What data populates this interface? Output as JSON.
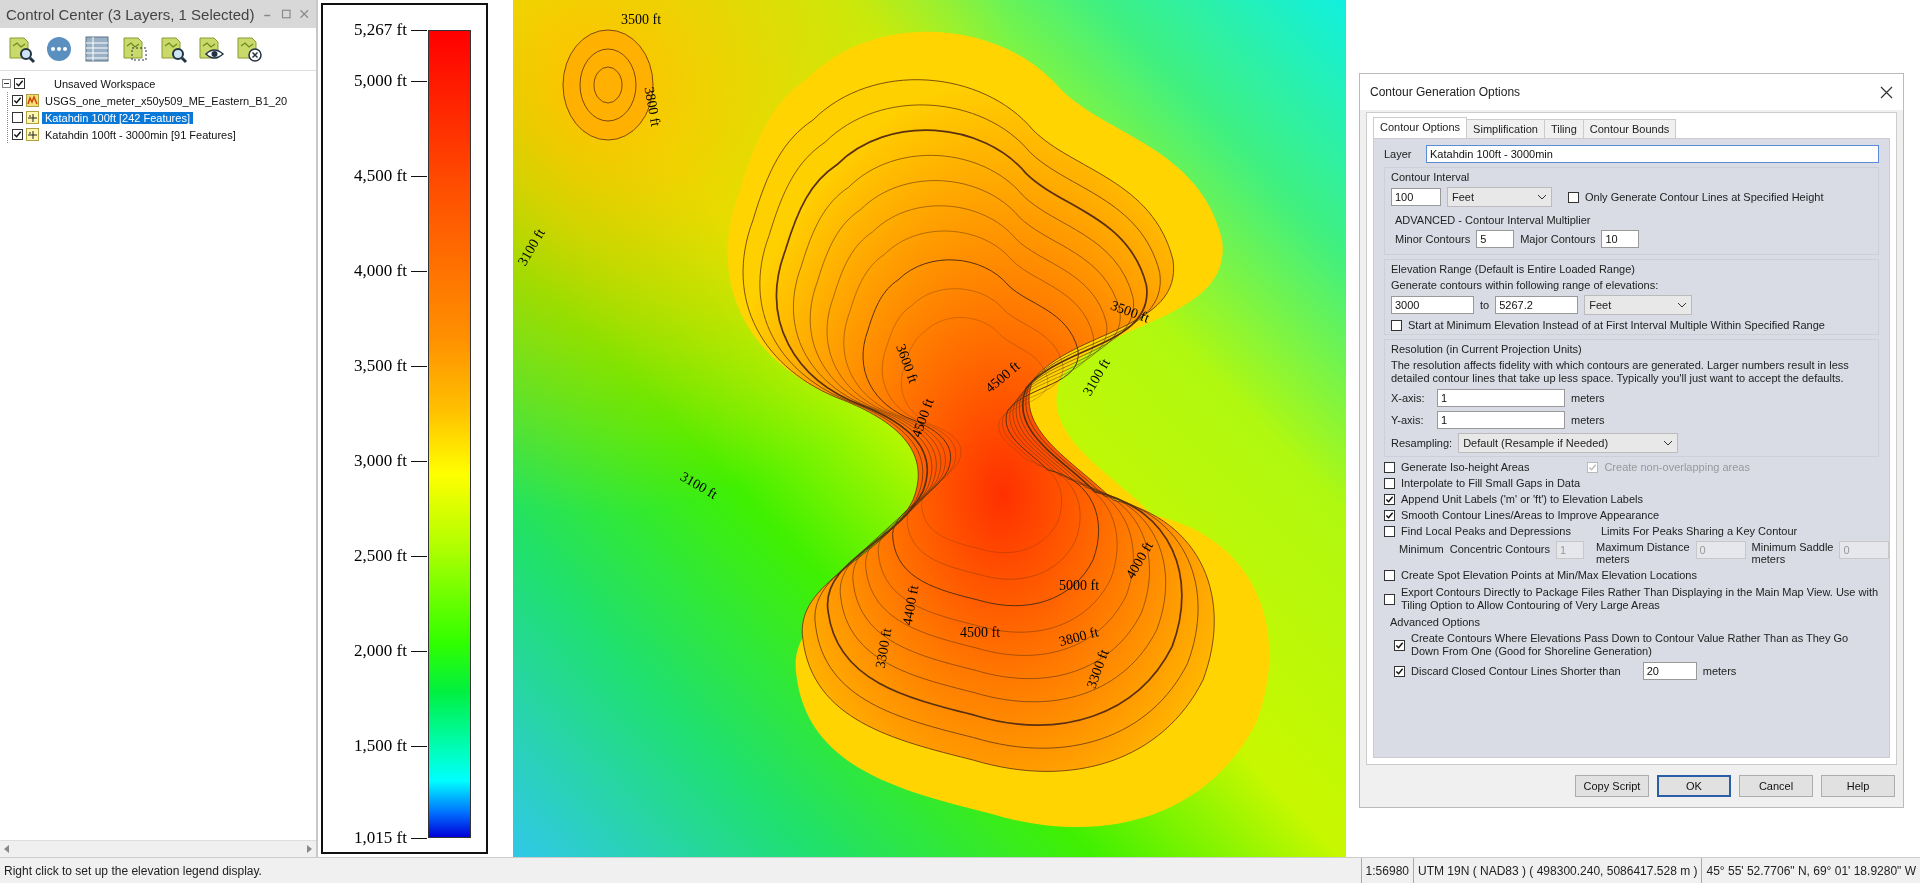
{
  "control_center": {
    "title": "Control Center (3 Layers, 1 Selected)",
    "tree": [
      {
        "label": "Unsaved Workspace",
        "checked": true,
        "expanded": true,
        "children": [
          {
            "label": "USGS_one_meter_x50y509_ME_Eastern_B1_20",
            "kind": "raster",
            "checked": true,
            "selected": false
          },
          {
            "label": "Katahdin 100ft [242 Features]",
            "kind": "vector",
            "checked": false,
            "selected": true
          },
          {
            "label": "Katahdin 100ft - 3000min [91 Features]",
            "kind": "vector",
            "checked": true,
            "selected": false
          }
        ]
      }
    ]
  },
  "legend": {
    "labels": [
      "5,267 ft",
      "5,000 ft",
      "4,500 ft",
      "4,000 ft",
      "3,500 ft",
      "3,000 ft",
      "2,500 ft",
      "2,000 ft",
      "1,500 ft",
      "1,015 ft"
    ]
  },
  "map": {
    "contour_labels": [
      "3500 ft",
      "3800 ft",
      "3100 ft",
      "3500 ft",
      "3600 ft",
      "4500 ft",
      "3100 ft",
      "4500 ft",
      "3100 ft",
      "5000 ft",
      "4000 ft",
      "4400 ft",
      "4500 ft",
      "3800 ft",
      "3300 ft",
      "3300 ft"
    ]
  },
  "dialog": {
    "title": "Contour Generation Options",
    "tabs": [
      {
        "label": "Contour Options",
        "selected": true
      },
      {
        "label": "Simplification",
        "selected": false
      },
      {
        "label": "Tiling",
        "selected": false
      },
      {
        "label": "Contour Bounds",
        "selected": false
      }
    ],
    "layer": {
      "label": "Layer",
      "value": "Katahdin 100ft - 3000min"
    },
    "interval": {
      "heading": "Contour Interval",
      "value": "100",
      "unit": "Feet",
      "only_specified": {
        "label": "Only Generate Contour Lines at Specified Height",
        "checked": false
      }
    },
    "multiplier": {
      "heading": "ADVANCED - Contour Interval Multiplier",
      "minor_label": "Minor Contours",
      "minor_value": "5",
      "major_label": "Major Contours",
      "major_value": "10"
    },
    "elevation_range": {
      "heading": "Elevation Range (Default is Entire Loaded Range)",
      "description": "Generate contours within following range of elevations:",
      "from": "3000",
      "to_label": "to",
      "to": "5267.2",
      "unit": "Feet",
      "start_at_min": {
        "label": "Start at Minimum Elevation Instead of at First Interval Multiple Within Specified Range",
        "checked": false
      }
    },
    "resolution": {
      "heading": "Resolution (in Current Projection Units)",
      "description": "The resolution affects fidelity with which contours are generated. Larger numbers result in less detailed contour lines that take up less space. Typically you'll just want to accept the defaults.",
      "x_label": "X-axis:",
      "x_value": "1",
      "x_unit": "meters",
      "y_label": "Y-axis:",
      "y_value": "1",
      "y_unit": "meters",
      "resampling_label": "Resampling:",
      "resampling": "Default (Resample if Needed)"
    },
    "iso": {
      "label": "Generate Iso-height Areas",
      "checked": false
    },
    "non_overlap": {
      "label": "Create non-overlapping areas",
      "checked": true
    },
    "options": [
      {
        "label": "Interpolate to Fill Small Gaps in Data",
        "checked": false
      },
      {
        "label": "Append Unit Labels ('m' or 'ft') to Elevation Labels",
        "checked": true
      },
      {
        "label": "Smooth Contour Lines/Areas to Improve Appearance",
        "checked": true
      }
    ],
    "peaks": {
      "label": "Find Local Peaks and Depressions",
      "checked": false,
      "limits_heading": "Limits For Peaks Sharing a Key Contour",
      "min_concentric_label": "Minimum  Concentric Contours",
      "min_concentric_value": "1",
      "max_distance_label": "Maximum Distance",
      "max_distance_unit": "meters",
      "max_distance_value": "0",
      "min_saddle_label": "Minimum Saddle",
      "min_saddle_unit": "meters",
      "min_saddle_value": "0"
    },
    "options2": [
      {
        "label": "Create Spot Elevation Points at Min/Max Elevation Locations",
        "checked": false
      },
      {
        "label": "Export Contours Directly to Package Files Rather Than Displaying in the Main Map View. Use with Tiling Option to Allow Contouring of Very Large Areas",
        "checked": false
      }
    ],
    "advanced": {
      "heading": "Advanced Options",
      "pass_down": {
        "label": "Create Contours Where Elevations Pass Down to Contour Value Rather Than as They Go Down From One (Good for Shoreline Generation)",
        "checked": true
      },
      "discard": {
        "label": "Discard Closed Contour Lines Shorter than",
        "checked": true,
        "value": "20",
        "unit": "meters"
      }
    },
    "buttons": [
      {
        "label": "Copy Script",
        "default": false
      },
      {
        "label": "OK",
        "default": true
      },
      {
        "label": "Cancel",
        "default": false
      },
      {
        "label": "Help",
        "default": false
      }
    ]
  },
  "status_bar": {
    "message": "Right click to set up the elevation legend display.",
    "scale": "1:56980",
    "projection": "UTM 19N ( NAD83 ) ( 498300.240, 5086417.528 m )",
    "latlon": "45° 55' 52.7706\" N, 69° 01' 18.9280\" W"
  }
}
